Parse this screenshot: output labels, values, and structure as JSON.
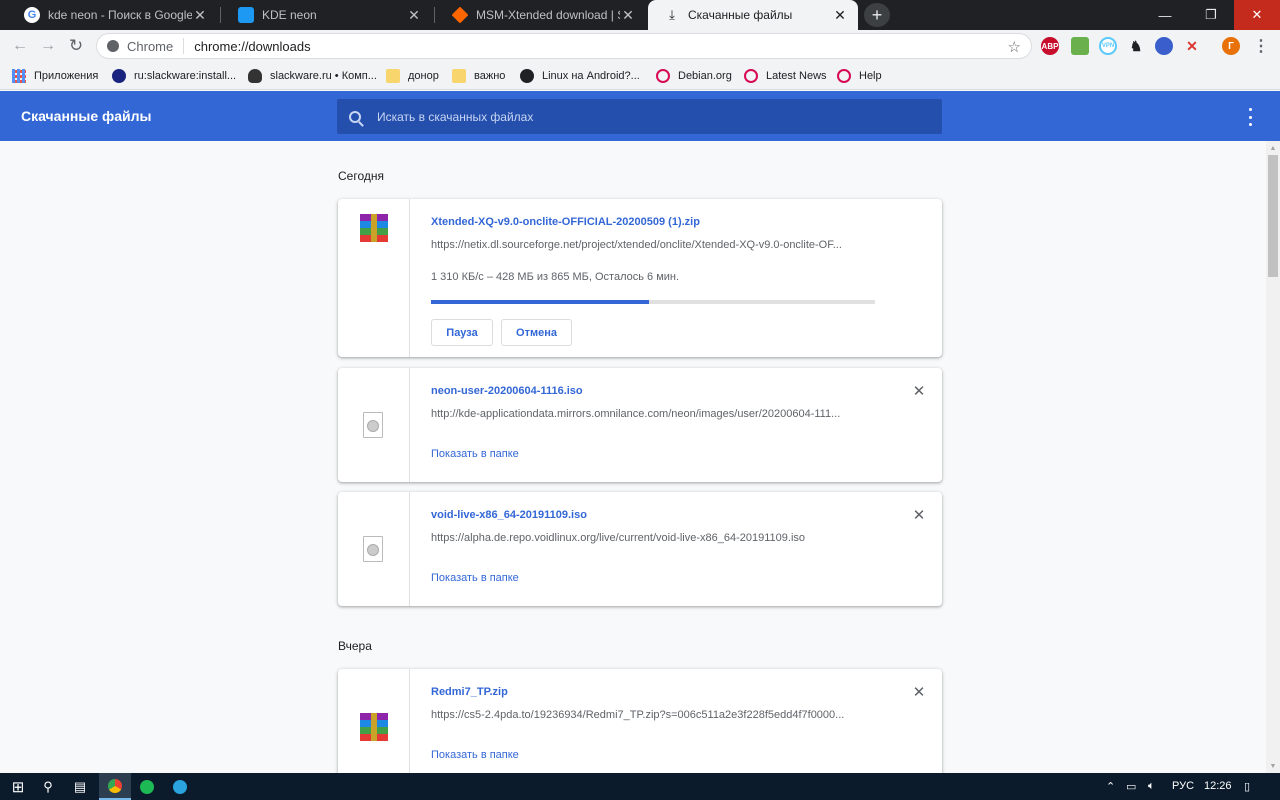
{
  "tabs": [
    {
      "title": "kde neon - Поиск в Google",
      "favicon_color": "#ffffff"
    },
    {
      "title": "KDE neon",
      "favicon_color": "#1d99f3"
    },
    {
      "title": "MSM-Xtended download | Sour",
      "favicon_color": "#ff6600"
    },
    {
      "title": "Скачанные файлы",
      "favicon_color": "#202124"
    }
  ],
  "omnibox": {
    "scheme": "Chrome",
    "url": "chrome://downloads"
  },
  "extensions": [
    {
      "name": "adblock-icon",
      "label": "ABP",
      "color": "#c70d2c"
    },
    {
      "name": "android-extension-icon",
      "label": "",
      "color": "#6ab04c"
    },
    {
      "name": "vpn-icon",
      "label": "VPN",
      "color": "#5ac8fa"
    },
    {
      "name": "gnome-icon",
      "label": "",
      "color": "#202124"
    },
    {
      "name": "globe-icon",
      "label": "",
      "color": "#3a5fcd"
    },
    {
      "name": "tools-icon",
      "label": "",
      "color": "#d33"
    },
    {
      "name": "profile-avatar",
      "label": "Г",
      "color": "#e8710a"
    }
  ],
  "bookmarks": [
    {
      "label": "Приложения",
      "icon": "apps-grid-icon"
    },
    {
      "label": "ru:slackware:install...",
      "icon": "slackware-icon"
    },
    {
      "label": "slackware.ru • Комп...",
      "icon": "tux-icon"
    },
    {
      "label": "донор",
      "icon": "folder-icon"
    },
    {
      "label": "важно",
      "icon": "folder-icon"
    },
    {
      "label": "Linux на Android?...",
      "icon": "globe-icon"
    },
    {
      "label": "Debian.org",
      "icon": "debian-icon"
    },
    {
      "label": "Latest News",
      "icon": "debian-icon"
    },
    {
      "label": "Help",
      "icon": "debian-icon"
    }
  ],
  "page": {
    "title": "Скачанные файлы",
    "search_placeholder": "Искать в скачанных файлах"
  },
  "sections": {
    "today": "Сегодня",
    "yesterday": "Вчера"
  },
  "downloads": [
    {
      "filename": "Xtended-XQ-v9.0-onclite-OFFICIAL-20200509 (1).zip",
      "url": "https://netix.dl.sourceforge.net/project/xtended/onclite/Xtended-XQ-v9.0-onclite-OF...",
      "status": "1 310 КБ/с – 428 МБ из 865 МБ, Осталось 6 мин.",
      "progress_fraction": 0.49,
      "pause_label": "Пауза",
      "cancel_label": "Отмена",
      "file_icon": "winrar-archive-icon"
    },
    {
      "filename": "neon-user-20200604-1116.iso",
      "url": "http://kde-applicationdata.mirrors.omnilance.com/neon/images/user/20200604-111...",
      "show_in_folder": "Показать в папке",
      "file_icon": "disc-image-icon"
    },
    {
      "filename": "void-live-x86_64-20191109.iso",
      "url": "https://alpha.de.repo.voidlinux.org/live/current/void-live-x86_64-20191109.iso",
      "show_in_folder": "Показать в папке",
      "file_icon": "disc-image-icon"
    },
    {
      "filename": "Redmi7_TP.zip",
      "url": "https://cs5-2.4pda.to/19236934/Redmi7_TP.zip?s=006c511a2e3f228f5edd4f7f0000...",
      "show_in_folder": "Показать в папке",
      "file_icon": "winrar-archive-icon"
    }
  ],
  "taskbar": {
    "language": "РУС",
    "time": "12:26"
  },
  "colors": {
    "header_blue": "#3367d6",
    "link_blue": "#3367d6"
  }
}
